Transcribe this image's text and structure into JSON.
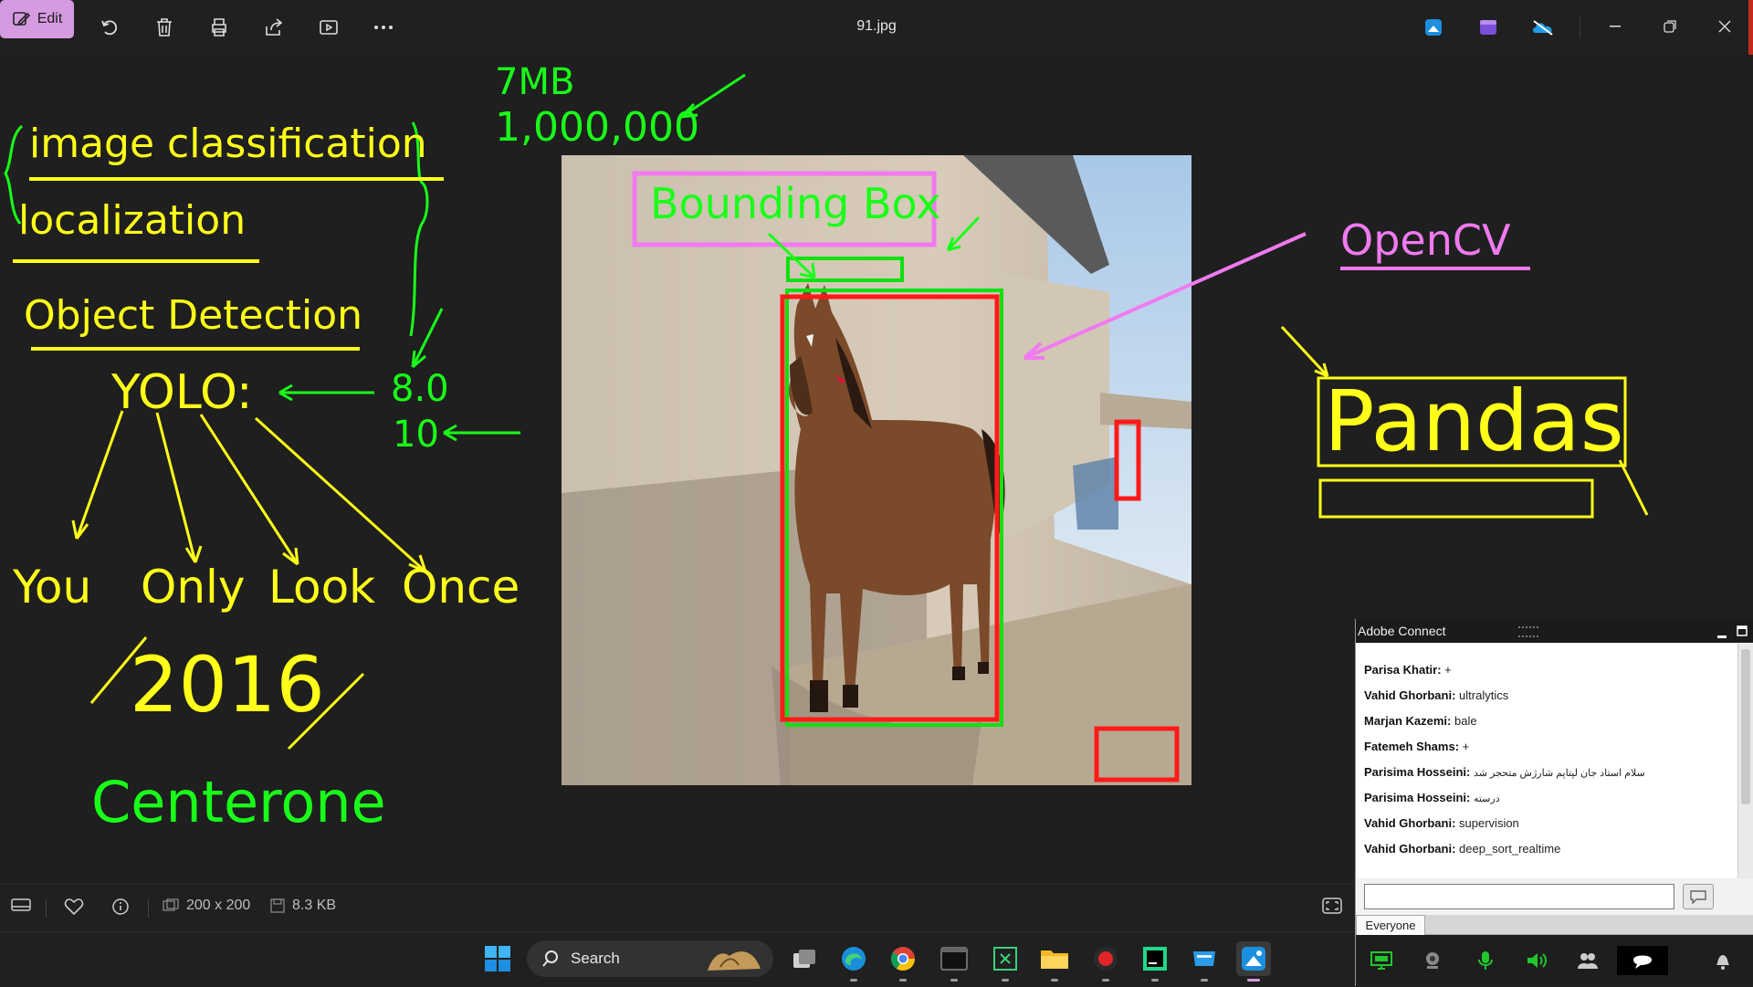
{
  "toolbar": {
    "edit_label": "Edit",
    "file_title": "91.jpg"
  },
  "annotations": {
    "size_mb": "7MB",
    "count": "1,000,000",
    "image_classification": "image classification",
    "localization": "localization",
    "object_detection": "Object Detection",
    "yolo": "YOLO:",
    "v8": "8.0",
    "v10": "10",
    "you": "You",
    "only": "Only",
    "look": "Look",
    "once": "Once",
    "year": "2016",
    "centerone": "Centerone",
    "bounding_box": "Bounding Box",
    "opencv": "OpenCV",
    "pandas": "Pandas"
  },
  "status": {
    "dimensions": "200 x 200",
    "file_size": "8.3 KB"
  },
  "taskbar": {
    "search_label": "Search"
  },
  "adobe_connect": {
    "title": "Adobe Connect",
    "messages": [
      {
        "sender": "Parisa Khatir:",
        "text": "+"
      },
      {
        "sender": "Vahid Ghorbani:",
        "text": "ultralytics"
      },
      {
        "sender": "Marjan Kazemi:",
        "text": "bale"
      },
      {
        "sender": "Fatemeh Shams:",
        "text": "+"
      },
      {
        "sender": "Parisima Hosseini:",
        "text": "سلام استاد جان لپتاپم شارژش متحجر شد"
      },
      {
        "sender": "Parisima Hosseini:",
        "text": "درسته"
      },
      {
        "sender": "Vahid Ghorbani:",
        "text": "supervision"
      },
      {
        "sender": "Vahid Ghorbani:",
        "text": "deep_sort_realtime"
      }
    ],
    "tab_label": "Everyone"
  }
}
